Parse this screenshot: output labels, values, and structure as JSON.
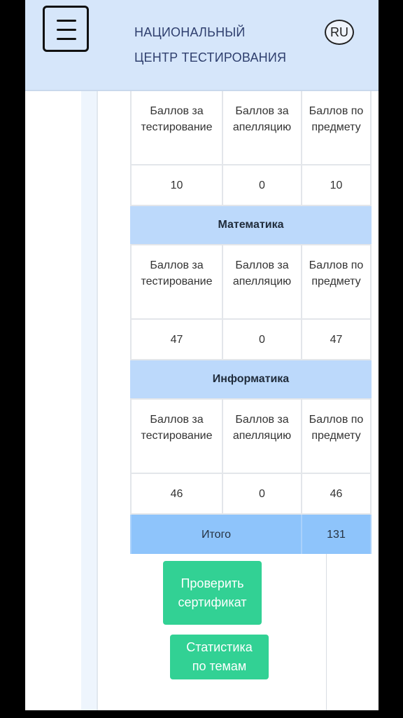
{
  "header": {
    "brand_line1": "НАЦИОНАЛЬНЫЙ",
    "brand_line2": "ЦЕНТР ТЕСТИРОВАНИЯ",
    "lang": "RU",
    "menu_icon": "hamburger-icon"
  },
  "first_block": {
    "columns": [
      "Баллов за тестирование",
      "Баллов за апелляцию",
      "Баллов по предмету"
    ],
    "values": [
      "10",
      "0",
      "10"
    ]
  },
  "subjects": [
    {
      "name": "Математика",
      "columns": [
        "Баллов за тестирование",
        "Баллов за апелляцию",
        "Баллов по предмету"
      ],
      "values": [
        "47",
        "0",
        "47"
      ]
    },
    {
      "name": "Информатика",
      "columns": [
        "Баллов за тестирование",
        "Баллов за апелляцию",
        "Баллов по предмету"
      ],
      "values": [
        "46",
        "0",
        "46"
      ]
    }
  ],
  "total": {
    "label": "Итого",
    "value": "131"
  },
  "buttons": {
    "check_certificate": "Проверить сертификат",
    "topic_statistics": "Статистика по темам"
  },
  "colors": {
    "header_bg": "#d6e6fa",
    "subject_bg": "#bcd9fb",
    "total_bg": "#8ec4fb",
    "button_bg": "#32d194"
  }
}
